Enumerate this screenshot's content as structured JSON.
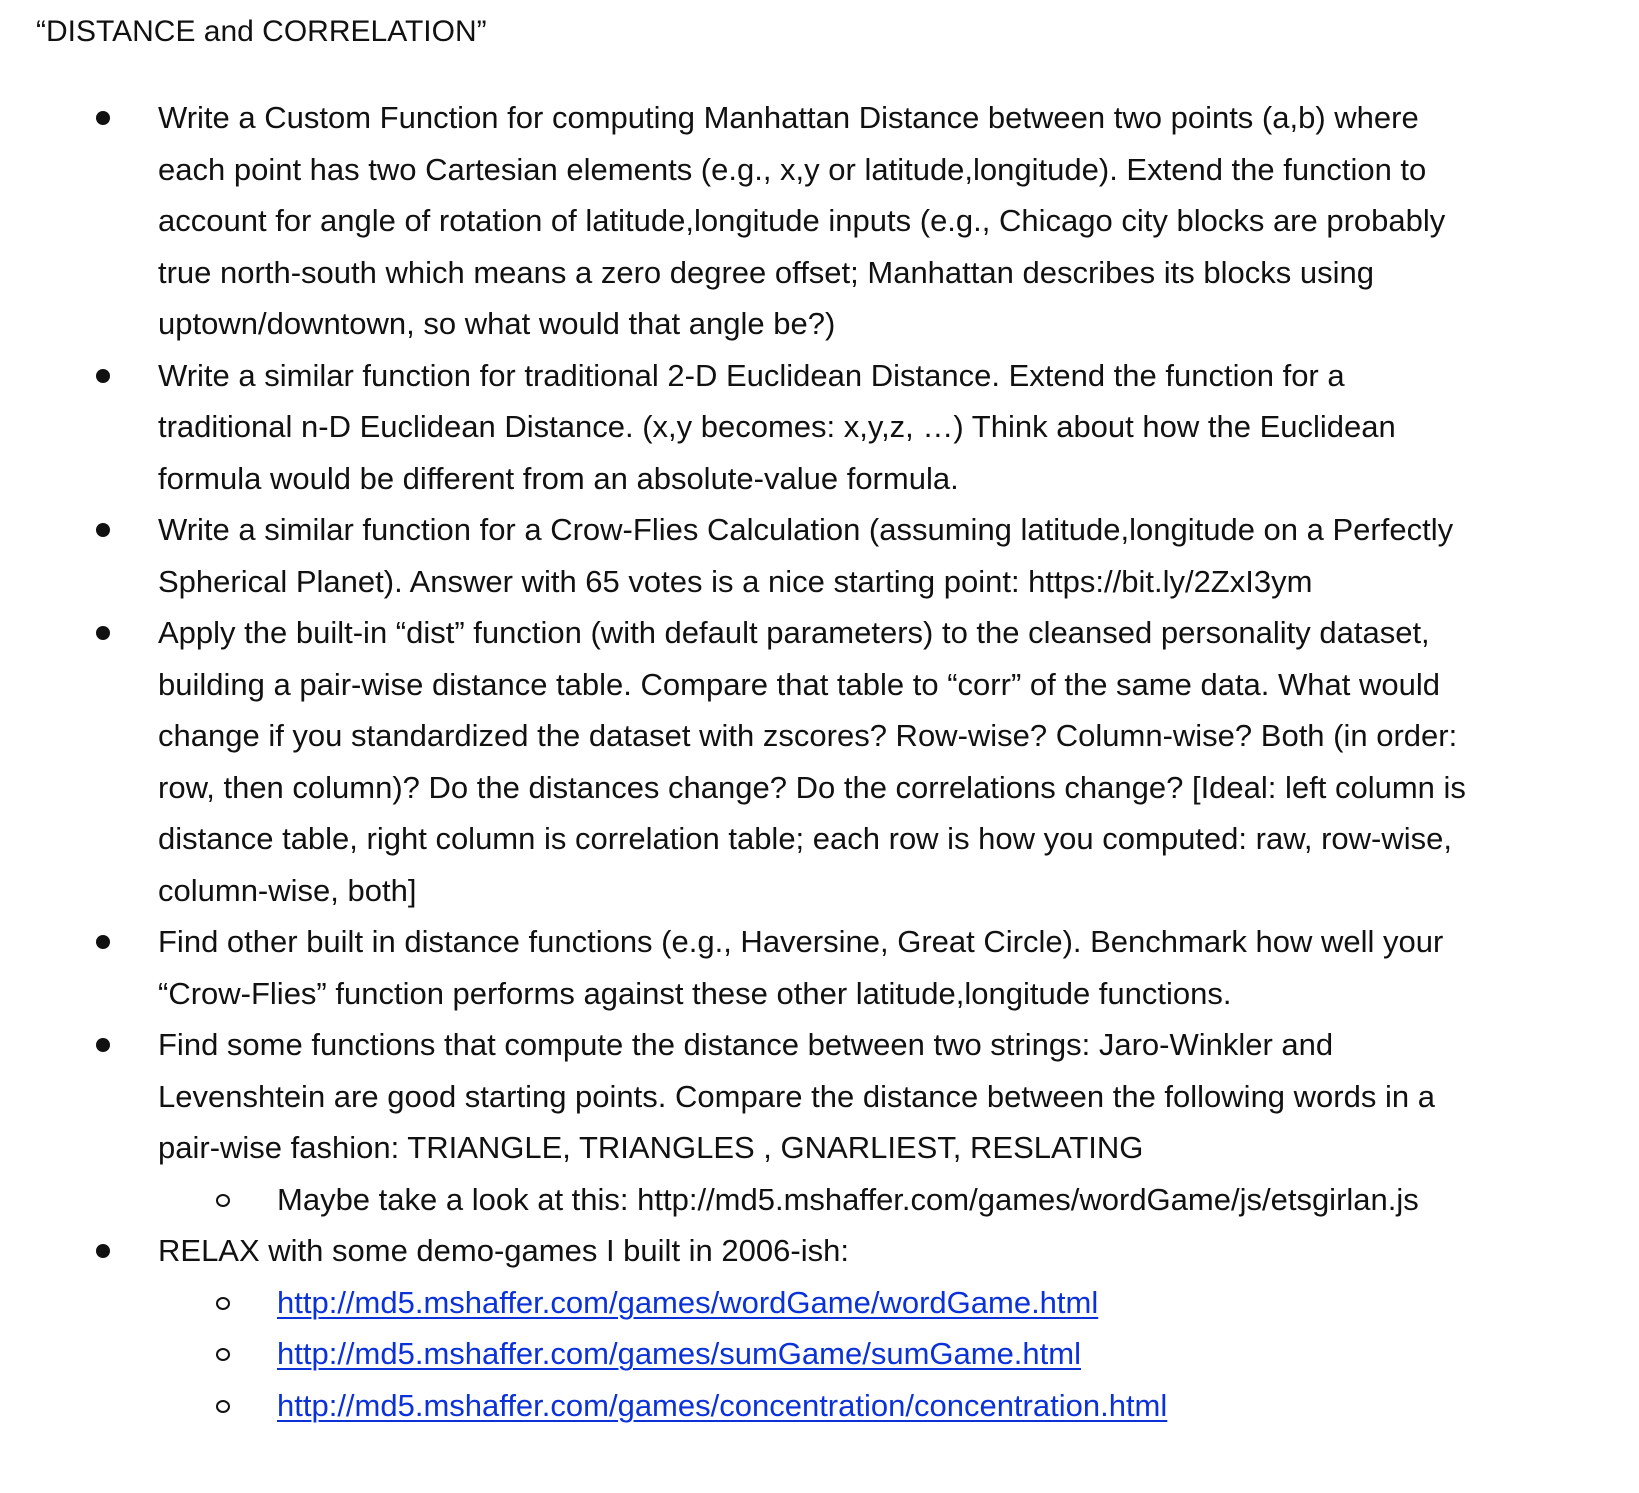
{
  "title": "“DISTANCE and CORRELATION”",
  "colors": {
    "text": "#111111",
    "link": "#0b31d9",
    "background": "#ffffff"
  },
  "bullets": [
    {
      "lines": [
        "Write a Custom Function for computing Manhattan Distance between two points (a,b) where",
        "each point has two Cartesian elements (e.g., x,y or latitude,longitude).  Extend the function to",
        "account for angle of rotation of latitude,longitude inputs (e.g., Chicago city blocks are probably",
        "true north-south which means a zero degree offset; Manhattan describes its blocks using",
        "uptown/downtown, so what would that angle be?)"
      ]
    },
    {
      "lines": [
        "Write a similar function for traditional 2-D Euclidean Distance.  Extend the function for a",
        "traditional n-D Euclidean Distance.  (x,y becomes: x,y,z, …)  Think about how the Euclidean",
        "formula would be different from an absolute-value formula."
      ]
    },
    {
      "lines": [
        "Write a similar function for a Crow-Flies Calculation (assuming latitude,longitude on a Perfectly",
        "Spherical Planet).  Answer with 65 votes is a nice starting point:  https://bit.ly/2ZxI3ym"
      ]
    },
    {
      "lines": [
        "Apply the built-in “dist” function (with default parameters) to the cleansed personality dataset,",
        "building a pair-wise distance table.  Compare that table to “corr” of the same data.  What would",
        "change if you standardized the dataset with zscores?  Row-wise?  Column-wise?  Both (in order:",
        "row, then column)?  Do the distances change?  Do the correlations change? [Ideal: left column is",
        "distance table, right column is correlation table; each row is how you computed: raw, row-wise,",
        "column-wise, both]"
      ]
    },
    {
      "lines": [
        "Find other built in distance functions (e.g., Haversine, Great Circle).  Benchmark how well your",
        "“Crow-Flies” function performs against these other latitude,longitude functions."
      ]
    },
    {
      "lines": [
        "Find some functions that compute the distance between two strings:  Jaro-Winkler and",
        "Levenshtein are good starting points.  Compare the distance between the following words in a",
        "pair-wise fashion:  TRIANGLE, TRIANGLES , GNARLIEST, RESLATING"
      ],
      "sub_items": [
        "Maybe take a look at this:   http://md5.mshaffer.com/games/wordGame/js/etsgirlan.js"
      ]
    },
    {
      "lines": [
        "RELAX with some demo-games I built in 2006-ish:"
      ],
      "links": [
        "http://md5.mshaffer.com/games/wordGame/wordGame.html",
        "http://md5.mshaffer.com/games/sumGame/sumGame.html",
        "http://md5.mshaffer.com/games/concentration/concentration.html"
      ]
    }
  ]
}
